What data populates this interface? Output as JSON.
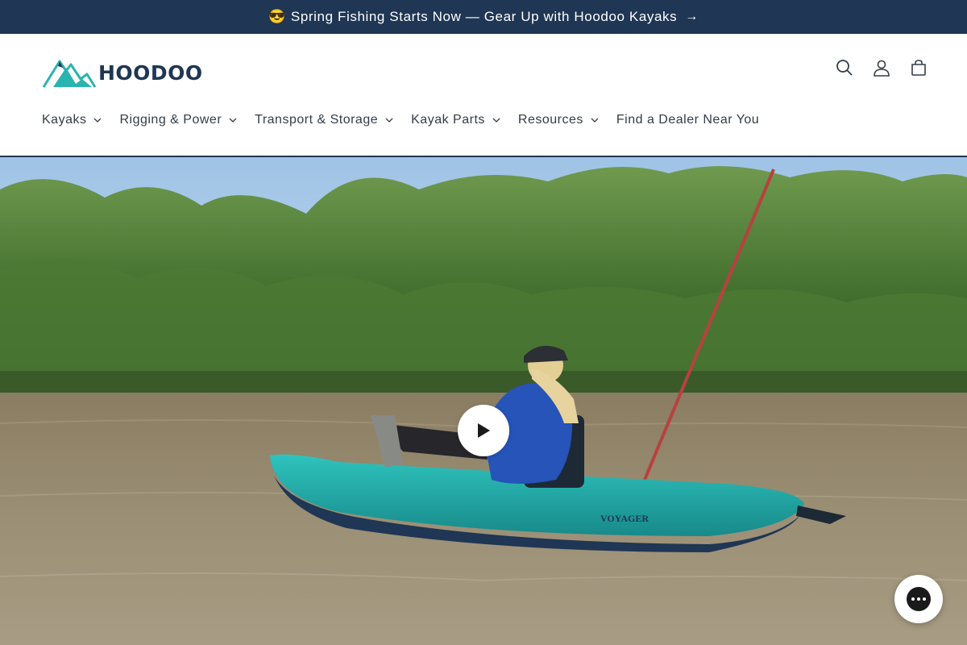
{
  "announcement": {
    "emoji": "😎",
    "text": "Spring Fishing Starts Now — Gear Up with Hoodoo Kayaks",
    "arrow": "→"
  },
  "logo": {
    "text": "HOODOO"
  },
  "header_icons": [
    "search-icon",
    "account-icon",
    "cart-icon"
  ],
  "nav": {
    "items": [
      {
        "label": "Kayaks",
        "has_dropdown": true
      },
      {
        "label": "Rigging & Power",
        "has_dropdown": true
      },
      {
        "label": "Transport & Storage",
        "has_dropdown": true
      },
      {
        "label": "Kayak Parts",
        "has_dropdown": true
      },
      {
        "label": "Resources",
        "has_dropdown": true
      },
      {
        "label": "Find a Dealer Near You",
        "has_dropdown": false
      }
    ]
  },
  "hero": {
    "kayak_label": "VOYAGER",
    "play_icon": "play-icon"
  },
  "chat": {
    "icon": "chat-icon"
  },
  "colors": {
    "navy": "#1f3654",
    "teal": "#2bb3b0",
    "water": "#8a7f66"
  }
}
